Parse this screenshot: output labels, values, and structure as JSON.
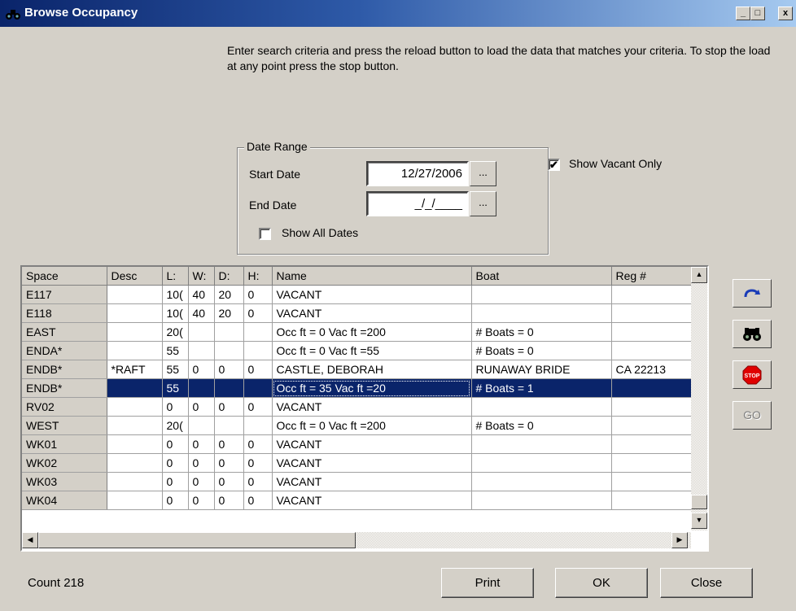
{
  "window": {
    "title": "Browse Occupancy",
    "minimize": "_",
    "restore": "□",
    "close": "x"
  },
  "instructions": "Enter search criteria and press the reload button to load the data that matches your criteria. To stop the load at any point press the stop button.",
  "date_range": {
    "legend": "Date Range",
    "start_label": "Start Date",
    "start_value": "12/27/2006",
    "end_label": "End Date",
    "end_value": "_/_/____",
    "ellipsis": "...",
    "show_all_label": "Show All Dates",
    "show_all_checked": false
  },
  "show_vacant": {
    "label": "Show Vacant Only",
    "checked": true
  },
  "grid": {
    "columns": [
      "Space",
      "Desc",
      "L:",
      "W:",
      "D:",
      "H:",
      "Name",
      "Boat",
      "Reg #"
    ],
    "rows": [
      [
        "E117",
        "",
        "10(",
        "40",
        "20",
        "0",
        "VACANT",
        "",
        ""
      ],
      [
        "E118",
        "",
        "10(",
        "40",
        "20",
        "0",
        "VACANT",
        "",
        ""
      ],
      [
        "EAST",
        "",
        "20(",
        "",
        "",
        "",
        "Occ ft = 0 Vac ft =200",
        "# Boats = 0",
        ""
      ],
      [
        "ENDA*",
        "",
        "55",
        "",
        "",
        "",
        "Occ ft = 0 Vac ft =55",
        "# Boats = 0",
        ""
      ],
      [
        "ENDB*",
        "*RAFT",
        "55",
        "0",
        "0",
        "0",
        "CASTLE, DEBORAH",
        "RUNAWAY BRIDE",
        "CA 22213"
      ],
      [
        "ENDB*",
        "",
        "55",
        "",
        "",
        "",
        "Occ ft = 35 Vac ft =20",
        "# Boats = 1",
        ""
      ],
      [
        "RV02",
        "",
        "0",
        "0",
        "0",
        "0",
        "VACANT",
        "",
        ""
      ],
      [
        "WEST",
        "",
        "20(",
        "",
        "",
        "",
        "Occ ft = 0 Vac ft =200",
        "# Boats = 0",
        ""
      ],
      [
        "WK01",
        "",
        "0",
        "0",
        "0",
        "0",
        "VACANT",
        "",
        ""
      ],
      [
        "WK02",
        "",
        "0",
        "0",
        "0",
        "0",
        "VACANT",
        "",
        ""
      ],
      [
        "WK03",
        "",
        "0",
        "0",
        "0",
        "0",
        "VACANT",
        "",
        ""
      ],
      [
        "WK04",
        "",
        "0",
        "0",
        "0",
        "0",
        "VACANT",
        "",
        ""
      ]
    ],
    "selected_row": 5
  },
  "side_buttons": {
    "reload_icon": "reload-icon",
    "search_icon": "binoculars-icon",
    "stop_label": "STOP",
    "go_label": "GO"
  },
  "footer": {
    "count": "Count 218",
    "print": "Print",
    "ok": "OK",
    "close": "Close"
  }
}
